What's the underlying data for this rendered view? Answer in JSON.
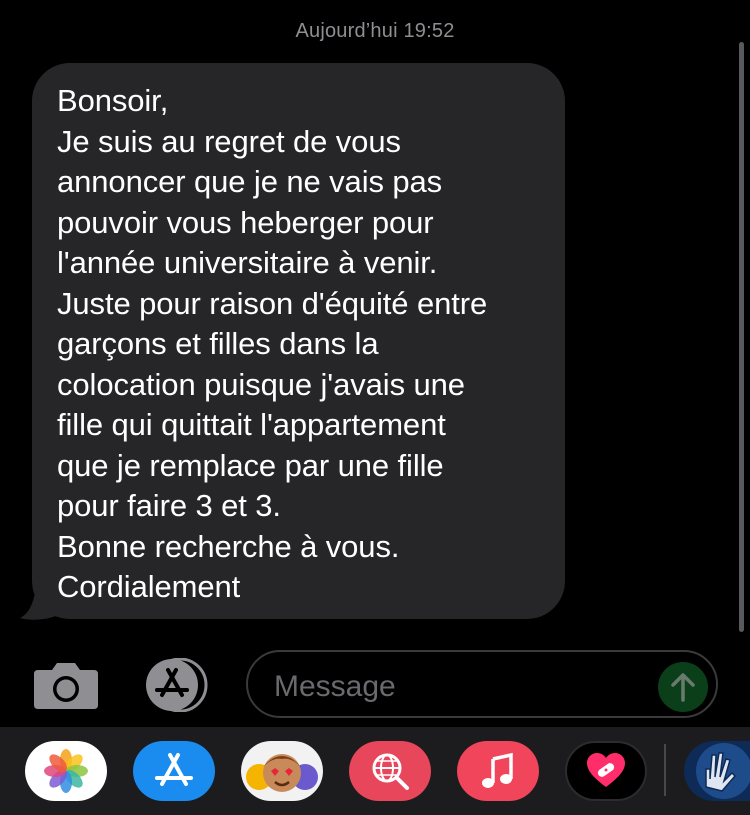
{
  "conversation": {
    "timestamp": "Aujourd’hui 19:52"
  },
  "message": {
    "lines": [
      "Bonsoir,",
      "Je suis au regret de vous",
      "annoncer que je ne vais pas",
      "pouvoir vous heberger pour",
      "l'année universitaire à venir.",
      "Juste pour raison d'équité entre",
      "garçons et filles dans la",
      "colocation puisque j'avais une",
      "fille qui quittait l'appartement",
      "que je remplace par une fille",
      "pour faire 3 et 3.",
      "Bonne recherche à vous.",
      "Cordialement"
    ]
  },
  "composer": {
    "placeholder": "Message",
    "camera_icon": "camera-icon",
    "apps_icon": "app-store-icon",
    "send_icon": "arrow-up-icon"
  },
  "app_drawer": {
    "apps": [
      {
        "name": "photos",
        "icon": "photos-icon"
      },
      {
        "name": "app-store",
        "icon": "app-store-icon"
      },
      {
        "name": "memoji",
        "icon": "memoji-icon"
      },
      {
        "name": "images-search",
        "icon": "globe-search-icon"
      },
      {
        "name": "music",
        "icon": "music-note-icon"
      },
      {
        "name": "digital-touch",
        "icon": "heart-icon"
      },
      {
        "name": "animoji",
        "icon": "hand-icon"
      }
    ]
  },
  "colors": {
    "background": "#000000",
    "bubble": "#262628",
    "timestamp": "#8e8e93",
    "placeholder": "#6a6a6e",
    "send_inactive": "#0b3f1a",
    "drawer": "#1c1c1e"
  }
}
